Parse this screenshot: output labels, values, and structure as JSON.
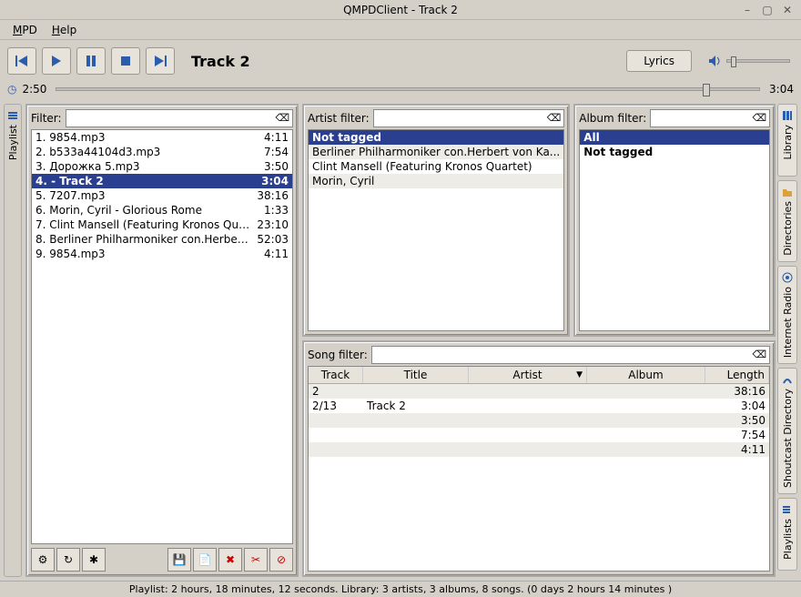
{
  "window": {
    "title": "QMPDClient - Track 2"
  },
  "menu": {
    "mpd": "MPD",
    "help": "Help"
  },
  "toolbar": {
    "now_playing": "Track 2",
    "lyrics": "Lyrics"
  },
  "time": {
    "elapsed": "2:50",
    "total": "3:04",
    "seek_percent": 92
  },
  "left_tab": {
    "label": "Playlist"
  },
  "filters": {
    "playlist": "Filter:",
    "artist": "Artist filter:",
    "album": "Album filter:",
    "song": "Song filter:"
  },
  "playlist": {
    "items": [
      {
        "n": "1.",
        "title": "9854.mp3",
        "dur": "4:11"
      },
      {
        "n": "2.",
        "title": "b533a44104d3.mp3",
        "dur": "7:54"
      },
      {
        "n": "3.",
        "title": "Дорожка 5.mp3",
        "dur": "3:50"
      },
      {
        "n": "4.",
        "title": " - Track 2",
        "dur": "3:04"
      },
      {
        "n": "5.",
        "title": "7207.mp3",
        "dur": "38:16"
      },
      {
        "n": "6.",
        "title": "Morin, Cyril - Glorious Rome",
        "dur": "1:33"
      },
      {
        "n": "7.",
        "title": "Clint Mansell (Featuring Kronos Quartet) ...",
        "dur": "23:10"
      },
      {
        "n": "8.",
        "title": "Berliner Philharmoniker con.Herbert von ...",
        "dur": "52:03"
      },
      {
        "n": "9.",
        "title": "9854.mp3",
        "dur": "4:11"
      }
    ],
    "selected_index": 3
  },
  "artists": {
    "header": "Not tagged",
    "items": [
      "Berliner Philharmoniker con.Herbert von Ka...",
      "Clint Mansell (Featuring Kronos Quartet)",
      "Morin, Cyril"
    ]
  },
  "albums": {
    "header": "All",
    "items": [
      "Not tagged"
    ]
  },
  "song_table": {
    "columns": {
      "track": "Track",
      "title": "Title",
      "artist": "Artist",
      "album": "Album",
      "length": "Length"
    },
    "rows": [
      {
        "track": "2",
        "title": "",
        "artist": "",
        "album": "",
        "length": "38:16"
      },
      {
        "track": "2/13",
        "title": "Track 2",
        "artist": "",
        "album": "",
        "length": "3:04"
      },
      {
        "track": "",
        "title": "",
        "artist": "",
        "album": "",
        "length": "3:50"
      },
      {
        "track": "",
        "title": "",
        "artist": "",
        "album": "",
        "length": "7:54"
      },
      {
        "track": "",
        "title": "",
        "artist": "",
        "album": "",
        "length": "4:11"
      }
    ]
  },
  "side_tabs": {
    "library": "Library",
    "directories": "Directories",
    "internet_radio": "Internet Radio",
    "shoutcast": "Shoutcast Directory",
    "playlists": "Playlists"
  },
  "status": "Playlist: 2 hours, 18 minutes, 12 seconds.  Library:  3 artists, 3 albums, 8 songs. (0 days 2 hours 14 minutes )"
}
